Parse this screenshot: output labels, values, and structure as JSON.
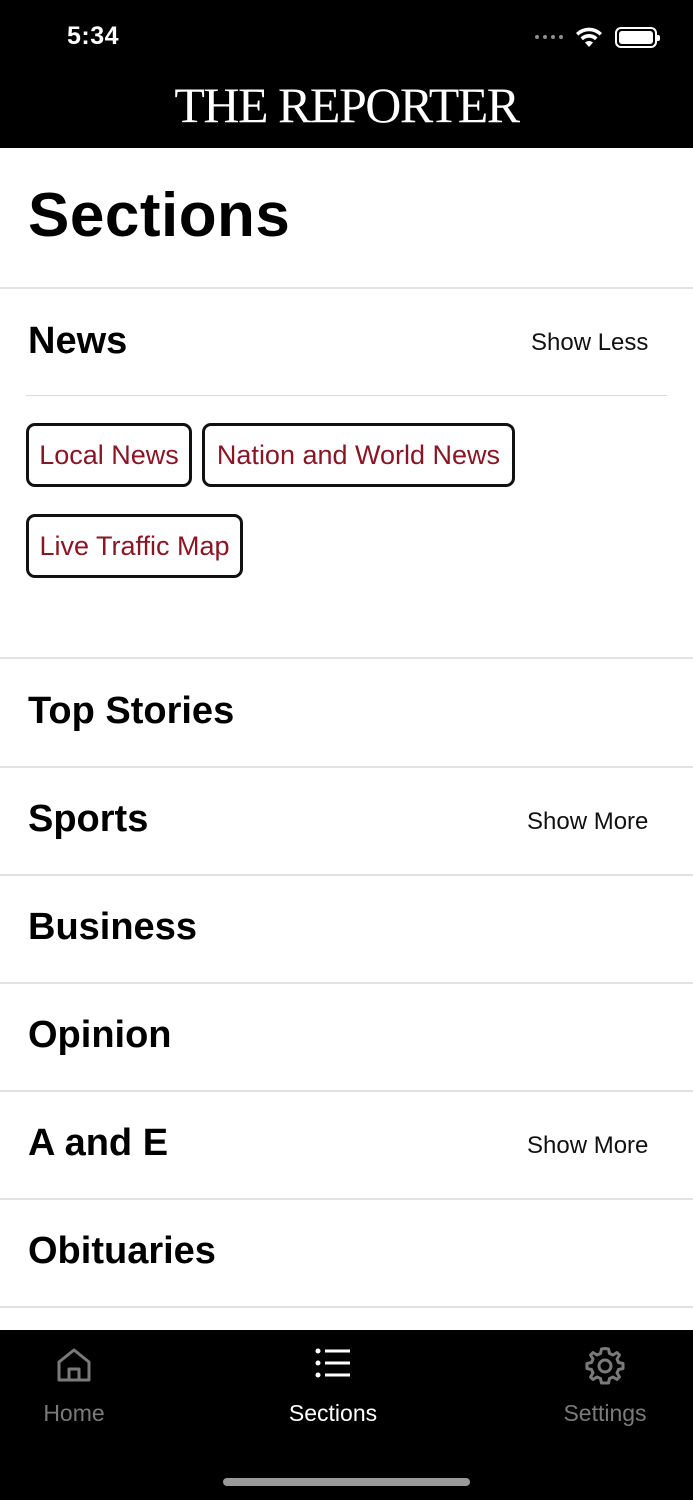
{
  "status_bar": {
    "time": "5:34"
  },
  "header": {
    "logo": "THE REPORTER"
  },
  "page": {
    "title": "Sections"
  },
  "sections": {
    "news": {
      "title": "News",
      "action": "Show Less",
      "subsections": [
        "Local News",
        "Nation and World News",
        "Live Traffic Map"
      ]
    },
    "items": [
      {
        "title": "Top Stories",
        "action": ""
      },
      {
        "title": "Sports",
        "action": "Show More"
      },
      {
        "title": "Business",
        "action": ""
      },
      {
        "title": "Opinion",
        "action": ""
      },
      {
        "title": "A and E",
        "action": "Show More"
      },
      {
        "title": "Obituaries",
        "action": ""
      }
    ]
  },
  "tabbar": {
    "tabs": [
      {
        "label": "Home",
        "icon": "home-icon",
        "active": false
      },
      {
        "label": "Sections",
        "icon": "list-icon",
        "active": true
      },
      {
        "label": "Settings",
        "icon": "gear-icon",
        "active": false
      }
    ]
  },
  "colors": {
    "accent": "#8a1524",
    "header_bg": "#000000",
    "inactive_tab": "#7a7a7a"
  }
}
